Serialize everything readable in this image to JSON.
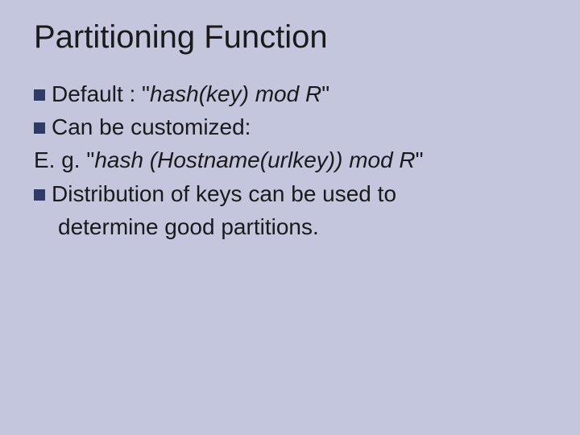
{
  "slide": {
    "title": "Partitioning Function",
    "lines": {
      "l1_pre": "Default : \"",
      "l1_ital": "hash(key) mod R",
      "l1_post": "\"",
      "l2": "Can be customized:",
      "l3_pre": "E. g. \"",
      "l3_ital": "hash (Hostname(urlkey)) mod R",
      "l3_post": "\"",
      "l4a": "Distribution of keys can be used to",
      "l4b": "determine good partitions."
    }
  }
}
